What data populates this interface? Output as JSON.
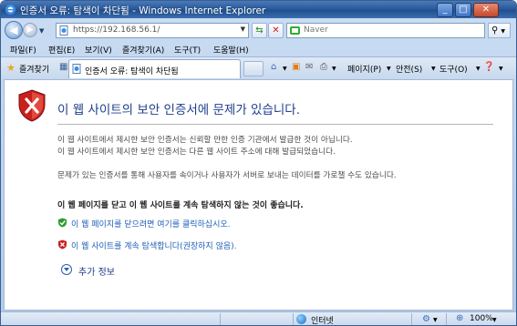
{
  "window": {
    "title": "인증서 오류: 탐색이 차단됨 - Windows Internet Explorer",
    "minimize": "_",
    "maximize": "□",
    "close": "✕"
  },
  "address": {
    "url": "https://192.168.56.1/",
    "search_placeholder": "Naver"
  },
  "menu": [
    "파일(F)",
    "편집(E)",
    "보기(V)",
    "즐겨찾기(A)",
    "도구(T)",
    "도움말(H)"
  ],
  "tabbar": {
    "favorites": "즐겨찾기",
    "tab_title": "인증서 오류: 탐색이 차단됨",
    "commands": {
      "page": "페이지(P)",
      "safety": "안전(S)",
      "tools": "도구(O)"
    }
  },
  "content": {
    "title": "이 웹 사이트의 보안 인증서에 문제가 있습니다.",
    "para1_line1": "이 웹 사이트에서 제시한 보안 인증서는 신뢰할 만한 인증 기관에서 발급한 것이 아닙니다.",
    "para1_line2": "이 웹 사이트에서 제시한 보안 인증서는 다른 웹 사이트 주소에 대해 발급되었습니다.",
    "para2": "문제가 있는 인증서를 통해 사용자를 속이거나 사용자가 서버로 보내는 데이터를 가로챌 수도 있습니다.",
    "recommendation": "이 웹 페이지를 닫고 이 웹 사이트를 계속 탐색하지 않는 것이 좋습니다.",
    "close_link": "이 웹 페이지를 닫으려면 여기를 클릭하십시오.",
    "continue_link": "이 웹 사이트를 계속 탐색합니다(권장하지 않음).",
    "more_info": "추가 정보"
  },
  "status": {
    "zone": "인터넷",
    "zoom": "100%"
  },
  "colors": {
    "title_blue": "#1f3d8c",
    "link_blue": "#1f5eb8",
    "shield_red": "#c8201c"
  }
}
